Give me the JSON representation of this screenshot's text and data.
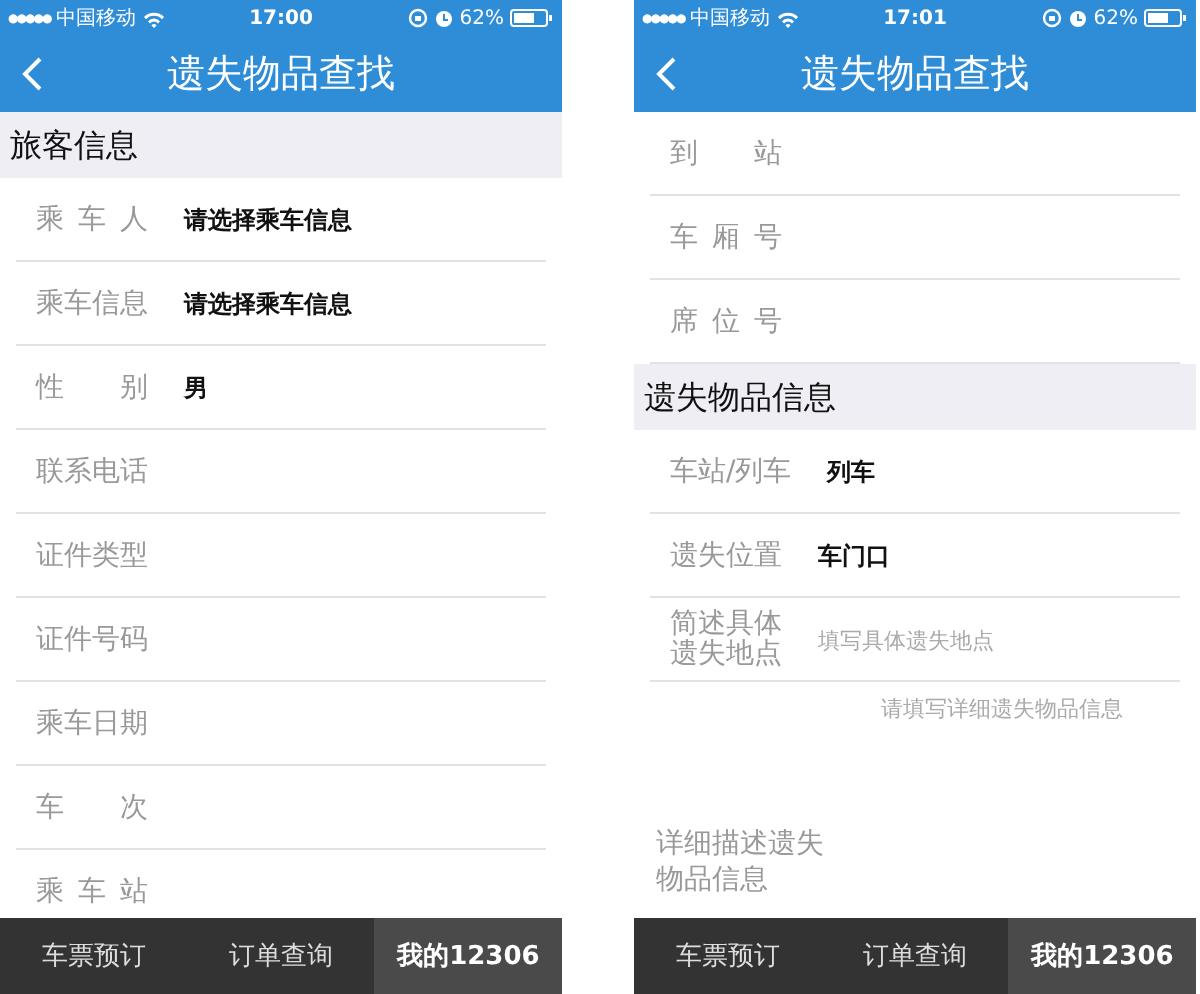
{
  "screens": [
    {
      "status_bar": {
        "signal": "●●●●●",
        "carrier": "中国移动",
        "time": "17:00",
        "battery": "62%"
      },
      "title": "遗失物品查找",
      "items": [
        {
          "kind": "section",
          "label": "旅客信息"
        },
        {
          "kind": "field",
          "label": "乘车人",
          "value": "请选择乘车信息"
        },
        {
          "kind": "field",
          "label": "乘车信息",
          "value": "请选择乘车信息"
        },
        {
          "kind": "field",
          "label": "性别",
          "value": "男"
        },
        {
          "kind": "field",
          "label": "联系电话"
        },
        {
          "kind": "field",
          "label": "证件类型"
        },
        {
          "kind": "field",
          "label": "证件号码"
        },
        {
          "kind": "field",
          "label": "乘车日期"
        },
        {
          "kind": "field",
          "label": "车次"
        },
        {
          "kind": "field",
          "label": "乘车站"
        }
      ],
      "tabs": [
        {
          "label": "车票预订",
          "selected": false
        },
        {
          "label": "订单查询",
          "selected": false
        },
        {
          "label": "我的12306",
          "selected": true
        }
      ]
    },
    {
      "status_bar": {
        "signal": "●●●●●",
        "carrier": "中国移动",
        "time": "17:01",
        "battery": "62%"
      },
      "title": "遗失物品查找",
      "items": [
        {
          "kind": "field",
          "label": "到站"
        },
        {
          "kind": "field",
          "label": "车厢号"
        },
        {
          "kind": "field",
          "label": "席位号"
        },
        {
          "kind": "section",
          "label": "遗失物品信息"
        },
        {
          "kind": "field",
          "label": "车站/列车",
          "value": "列车"
        },
        {
          "kind": "field",
          "label": "遗失位置",
          "value": "车门口"
        },
        {
          "kind": "multiline",
          "label": "简述具体遗失地点",
          "placeholder": "填写具体遗失地点"
        },
        {
          "kind": "textarea",
          "label": "详细描述遗失物品信息",
          "placeholder": "请填写详细遗失物品信息"
        }
      ],
      "tabs": [
        {
          "label": "车票预订",
          "selected": false
        },
        {
          "label": "订单查询",
          "selected": false
        },
        {
          "label": "我的12306",
          "selected": true
        }
      ]
    }
  ]
}
